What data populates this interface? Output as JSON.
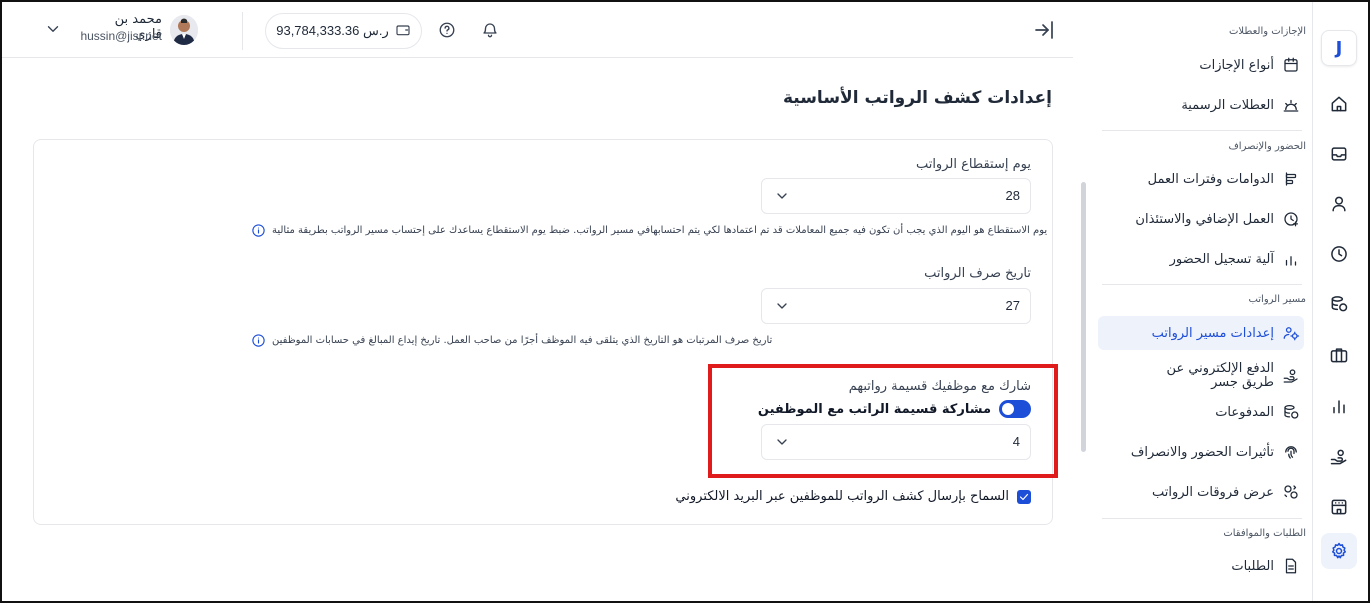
{
  "header": {
    "user_name": "محمد بن قازي",
    "user_email": "hussin@jisr.net",
    "balance": "93,784,333.36 ر.س"
  },
  "page": {
    "title": "إعدادات كشف الرواتب الأساسية"
  },
  "settings": {
    "deduction_day": {
      "label": "يوم إستقطاع الرواتب",
      "value": "28",
      "help": "يوم الاستقطاع هو اليوم الذي يجب أن تكون فيه جميع المعاملات قد تم اعتمادها لكي يتم احتسابهافي مسير الرواتب. ضبط يوم الاستقطاع يساعدك على إحتساب مسير الرواتب بطريقة مثالية"
    },
    "payment_date": {
      "label": "تاريخ صرف الرواتب",
      "value": "27",
      "help": "تاريخ صرف المرتبات هو التاريخ الذي يتلقى فيه الموظف أجرًا من صاحب العمل. تاريخ إيداع المبالغ في حسابات الموظفين"
    },
    "share_payslip": {
      "section_label": "شارك مع موظفيك قسيمة رواتبهم",
      "toggle_label": "مشاركة قسيمة الراتب مع الموظفين",
      "toggle_on": true,
      "value": "4"
    },
    "email_payslip": {
      "label": "السماح بإرسال كشف الرواتب للموظفين عبر البريد الالكتروني",
      "checked": true
    }
  },
  "nav": {
    "group_leaves": "الإجازات والعطلات",
    "leave_types": "أنواع الإجازات",
    "holidays": "العطلات الرسمية",
    "group_attendance": "الحضور والإنصراف",
    "shifts": "الدوامات وفترات العمل",
    "overtime": "العمل الإضافي والاستئذان",
    "attendance_mechanism": "آلية تسجيل الحضور",
    "group_payroll": "مسير الرواتب",
    "payroll_settings": "إعدادات مسير الرواتب",
    "e_payment": "الدفع الإلكتروني عن طريق جسر",
    "payments": "المدفوعات",
    "attendance_effects": "تأثيرات الحضور والانصراف",
    "payroll_diffs": "عرض فروقات الرواتب",
    "group_requests": "الطلبات والموافقات",
    "requests": "الطلبات"
  },
  "rail": {
    "logo": "J",
    "icons": [
      "home-icon",
      "inbox-icon",
      "user-icon",
      "clock-icon",
      "coins-icon",
      "briefcase-icon",
      "chart-icon",
      "hand-coins-icon",
      "building-icon",
      "gear-icon"
    ],
    "active": "gear-icon"
  },
  "colors": {
    "accent": "#1d4ed8",
    "highlight": "#e01b1b",
    "active_bg": "#eef2fb"
  }
}
